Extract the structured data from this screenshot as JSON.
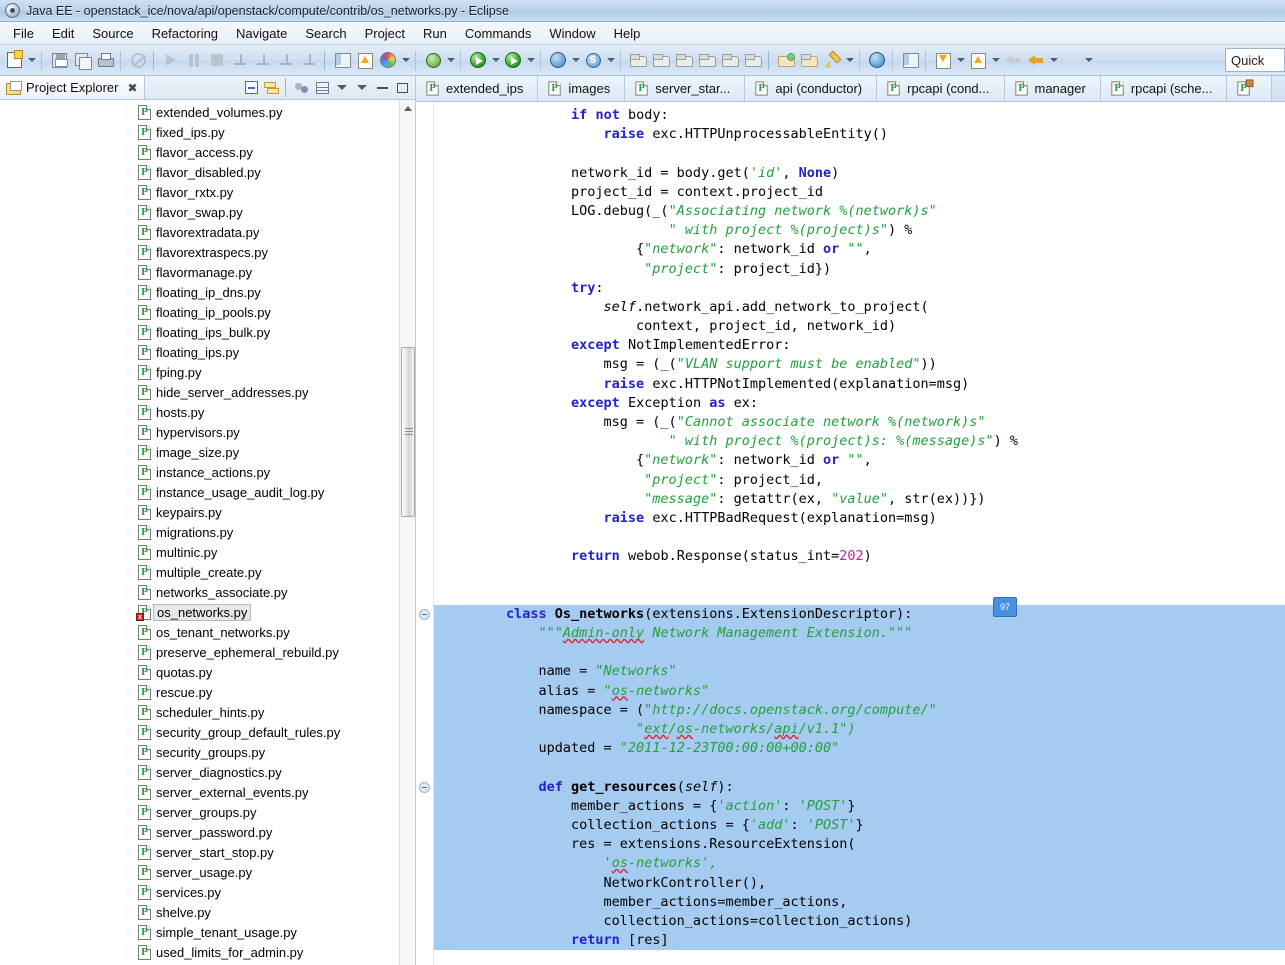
{
  "window": {
    "title": "Java EE - openstack_ice/nova/api/openstack/compute/contrib/os_networks.py - Eclipse",
    "icon": "eclipse-icon"
  },
  "menubar": {
    "items": [
      "File",
      "Edit",
      "Source",
      "Refactoring",
      "Navigate",
      "Search",
      "Project",
      "Run",
      "Commands",
      "Window",
      "Help"
    ]
  },
  "toolbar": {
    "quick_access_placeholder": "Quick ",
    "buttons": [
      "new-file",
      "new-file-dropdown",
      "save",
      "save-all",
      "print",
      "skip-breakpoints",
      "resume",
      "suspend",
      "terminate",
      "disconnect",
      "step-into",
      "step-over",
      "step-return",
      "next-annotation",
      "previous-annotation",
      "color-wheel",
      "color-dropdown",
      "debug-external-tools",
      "debug",
      "debug-dropdown",
      "run",
      "run-dropdown",
      "run-server",
      "run-server-dropdown",
      "new-web-project",
      "web-dropdown",
      "new-server",
      "server-dropdown",
      "package-1",
      "package-2",
      "package-3",
      "package-4",
      "package-5",
      "package-6",
      "open-package",
      "open-folder",
      "edit-pencil",
      "pencil-dropdown",
      "open-perspective",
      "browser",
      "pydev-package",
      "download-updates",
      "updates-dropdown",
      "upload",
      "upload-dropdown",
      "back",
      "back-dropdown",
      "forward",
      "forward-dropdown"
    ]
  },
  "project_explorer": {
    "title": "Project Explorer",
    "close_label": "✖",
    "tools": [
      "collapse-all",
      "link-with-editor",
      "filter",
      "view-menu",
      "minimize",
      "maximize"
    ],
    "files": [
      {
        "name": "extended_volumes.py",
        "selected": false,
        "error": false
      },
      {
        "name": "fixed_ips.py",
        "selected": false,
        "error": false
      },
      {
        "name": "flavor_access.py",
        "selected": false,
        "error": false
      },
      {
        "name": "flavor_disabled.py",
        "selected": false,
        "error": false
      },
      {
        "name": "flavor_rxtx.py",
        "selected": false,
        "error": false
      },
      {
        "name": "flavor_swap.py",
        "selected": false,
        "error": false
      },
      {
        "name": "flavorextradata.py",
        "selected": false,
        "error": false
      },
      {
        "name": "flavorextraspecs.py",
        "selected": false,
        "error": false
      },
      {
        "name": "flavormanage.py",
        "selected": false,
        "error": false
      },
      {
        "name": "floating_ip_dns.py",
        "selected": false,
        "error": false
      },
      {
        "name": "floating_ip_pools.py",
        "selected": false,
        "error": false
      },
      {
        "name": "floating_ips_bulk.py",
        "selected": false,
        "error": false
      },
      {
        "name": "floating_ips.py",
        "selected": false,
        "error": false
      },
      {
        "name": "fping.py",
        "selected": false,
        "error": false
      },
      {
        "name": "hide_server_addresses.py",
        "selected": false,
        "error": false
      },
      {
        "name": "hosts.py",
        "selected": false,
        "error": false
      },
      {
        "name": "hypervisors.py",
        "selected": false,
        "error": false
      },
      {
        "name": "image_size.py",
        "selected": false,
        "error": false
      },
      {
        "name": "instance_actions.py",
        "selected": false,
        "error": false
      },
      {
        "name": "instance_usage_audit_log.py",
        "selected": false,
        "error": false
      },
      {
        "name": "keypairs.py",
        "selected": false,
        "error": false
      },
      {
        "name": "migrations.py",
        "selected": false,
        "error": false
      },
      {
        "name": "multinic.py",
        "selected": false,
        "error": false
      },
      {
        "name": "multiple_create.py",
        "selected": false,
        "error": false
      },
      {
        "name": "networks_associate.py",
        "selected": false,
        "error": false
      },
      {
        "name": "os_networks.py",
        "selected": true,
        "error": true
      },
      {
        "name": "os_tenant_networks.py",
        "selected": false,
        "error": false
      },
      {
        "name": "preserve_ephemeral_rebuild.py",
        "selected": false,
        "error": false
      },
      {
        "name": "quotas.py",
        "selected": false,
        "error": false
      },
      {
        "name": "rescue.py",
        "selected": false,
        "error": false
      },
      {
        "name": "scheduler_hints.py",
        "selected": false,
        "error": false
      },
      {
        "name": "security_group_default_rules.py",
        "selected": false,
        "error": false
      },
      {
        "name": "security_groups.py",
        "selected": false,
        "error": false
      },
      {
        "name": "server_diagnostics.py",
        "selected": false,
        "error": false
      },
      {
        "name": "server_external_events.py",
        "selected": false,
        "error": false
      },
      {
        "name": "server_groups.py",
        "selected": false,
        "error": false
      },
      {
        "name": "server_password.py",
        "selected": false,
        "error": false
      },
      {
        "name": "server_start_stop.py",
        "selected": false,
        "error": false
      },
      {
        "name": "server_usage.py",
        "selected": false,
        "error": false
      },
      {
        "name": "services.py",
        "selected": false,
        "error": false
      },
      {
        "name": "shelve.py",
        "selected": false,
        "error": false
      },
      {
        "name": "simple_tenant_usage.py",
        "selected": false,
        "error": false
      },
      {
        "name": "used_limits_for_admin.py",
        "selected": false,
        "error": false
      }
    ]
  },
  "editor": {
    "tabs": [
      {
        "label": "extended_ips",
        "active": false,
        "modified": false
      },
      {
        "label": "images",
        "active": false,
        "modified": false
      },
      {
        "label": "server_star...",
        "active": false,
        "modified": false
      },
      {
        "label": "api (conductor)",
        "active": false,
        "modified": false
      },
      {
        "label": "rpcapi (cond...",
        "active": false,
        "modified": false
      },
      {
        "label": "manager",
        "active": false,
        "modified": false
      },
      {
        "label": "rpcapi (sche...",
        "active": false,
        "modified": false
      },
      {
        "label": "",
        "active": false,
        "modified": true
      }
    ],
    "ime_badge": "97",
    "code_lines": [
      {
        "indent": 8,
        "tokens": [
          {
            "t": "if",
            "c": "kw2"
          },
          {
            "t": " "
          },
          {
            "t": "not",
            "c": "kw2"
          },
          {
            "t": " body:"
          }
        ]
      },
      {
        "indent": 12,
        "tokens": [
          {
            "t": "raise",
            "c": "kw2"
          },
          {
            "t": " exc.HTTPUnprocessableEntity()"
          }
        ]
      },
      {
        "indent": 0,
        "tokens": []
      },
      {
        "indent": 8,
        "tokens": [
          {
            "t": "network_id = body.get("
          },
          {
            "t": "'id'",
            "c": "str"
          },
          {
            "t": ", "
          },
          {
            "t": "None",
            "c": "kw2"
          },
          {
            "t": ")"
          }
        ]
      },
      {
        "indent": 8,
        "tokens": [
          {
            "t": "project_id = context.project_id"
          }
        ]
      },
      {
        "indent": 8,
        "tokens": [
          {
            "t": "LOG.debug(_("
          },
          {
            "t": "\"Associating network %(network)s\"",
            "c": "str"
          }
        ]
      },
      {
        "indent": 20,
        "tokens": [
          {
            "t": "\" with project %(project)s\"",
            "c": "str"
          },
          {
            "t": ") %"
          }
        ]
      },
      {
        "indent": 16,
        "tokens": [
          {
            "t": "{"
          },
          {
            "t": "\"network\"",
            "c": "str"
          },
          {
            "t": ": network_id "
          },
          {
            "t": "or",
            "c": "kw2"
          },
          {
            "t": " "
          },
          {
            "t": "\"\"",
            "c": "str"
          },
          {
            "t": ","
          }
        ]
      },
      {
        "indent": 17,
        "tokens": [
          {
            "t": "\"project\"",
            "c": "str"
          },
          {
            "t": ": project_id})"
          }
        ]
      },
      {
        "indent": 8,
        "tokens": [
          {
            "t": "try",
            "c": "kw2"
          },
          {
            "t": ":"
          }
        ]
      },
      {
        "indent": 12,
        "tokens": [
          {
            "t": "self",
            "c": "it"
          },
          {
            "t": ".network_api.add_network_to_project("
          }
        ]
      },
      {
        "indent": 16,
        "tokens": [
          {
            "t": "context, project_id, network_id)"
          }
        ]
      },
      {
        "indent": 8,
        "tokens": [
          {
            "t": "except",
            "c": "kw2"
          },
          {
            "t": " NotImplementedError:"
          }
        ]
      },
      {
        "indent": 12,
        "tokens": [
          {
            "t": "msg = (_("
          },
          {
            "t": "\"VLAN support must be enabled\"",
            "c": "str"
          },
          {
            "t": "))"
          }
        ]
      },
      {
        "indent": 12,
        "tokens": [
          {
            "t": "raise",
            "c": "kw2"
          },
          {
            "t": " exc.HTTPNotImplemented(explanation=msg)"
          }
        ]
      },
      {
        "indent": 8,
        "tokens": [
          {
            "t": "except",
            "c": "kw2"
          },
          {
            "t": " Exception "
          },
          {
            "t": "as",
            "c": "kw2"
          },
          {
            "t": " ex:"
          }
        ]
      },
      {
        "indent": 12,
        "tokens": [
          {
            "t": "msg = (_("
          },
          {
            "t": "\"Cannot associate network %(network)s\"",
            "c": "str"
          }
        ]
      },
      {
        "indent": 20,
        "tokens": [
          {
            "t": "\" with project %(project)s: %(message)s\"",
            "c": "str"
          },
          {
            "t": ") %"
          }
        ]
      },
      {
        "indent": 16,
        "tokens": [
          {
            "t": "{"
          },
          {
            "t": "\"network\"",
            "c": "str"
          },
          {
            "t": ": network_id "
          },
          {
            "t": "or",
            "c": "kw2"
          },
          {
            "t": " "
          },
          {
            "t": "\"\"",
            "c": "str"
          },
          {
            "t": ","
          }
        ]
      },
      {
        "indent": 17,
        "tokens": [
          {
            "t": "\"project\"",
            "c": "str"
          },
          {
            "t": ": project_id,"
          }
        ]
      },
      {
        "indent": 17,
        "tokens": [
          {
            "t": "\"message\"",
            "c": "str"
          },
          {
            "t": ": getattr(ex, "
          },
          {
            "t": "\"value\"",
            "c": "str"
          },
          {
            "t": ", str(ex))})"
          }
        ]
      },
      {
        "indent": 12,
        "tokens": [
          {
            "t": "raise",
            "c": "kw2"
          },
          {
            "t": " exc.HTTPBadRequest(explanation=msg)"
          }
        ]
      },
      {
        "indent": 0,
        "tokens": []
      },
      {
        "indent": 8,
        "tokens": [
          {
            "t": "return",
            "c": "kw2"
          },
          {
            "t": " webob.Response(status_int="
          },
          {
            "t": "202",
            "c": "num"
          },
          {
            "t": ")"
          }
        ]
      },
      {
        "indent": 0,
        "tokens": []
      },
      {
        "indent": 0,
        "tokens": []
      }
    ],
    "selected_lines": [
      {
        "indent": 0,
        "fold": true,
        "tokens": [
          {
            "t": "class",
            "c": "kw2"
          },
          {
            "t": " "
          },
          {
            "t": "Os_networks",
            "c": "fn"
          },
          {
            "t": "(extensions.ExtensionDescriptor):"
          }
        ]
      },
      {
        "indent": 4,
        "tokens": [
          {
            "t": "\"\"\"",
            "c": "doc"
          },
          {
            "t": "Admin-only",
            "c": "doc sq"
          },
          {
            "t": " Network Management Extension.\"\"\"",
            "c": "doc"
          }
        ]
      },
      {
        "indent": 0,
        "tokens": []
      },
      {
        "indent": 4,
        "tokens": [
          {
            "t": "name = "
          },
          {
            "t": "\"Networks\"",
            "c": "str"
          }
        ]
      },
      {
        "indent": 4,
        "tokens": [
          {
            "t": "alias = "
          },
          {
            "t": "\"",
            "c": "str"
          },
          {
            "t": "os",
            "c": "str sq"
          },
          {
            "t": "-networks\"",
            "c": "str"
          }
        ]
      },
      {
        "indent": 4,
        "tokens": [
          {
            "t": "namespace = ("
          },
          {
            "t": "\"http://docs.openstack.org/compute/\"",
            "c": "str"
          }
        ]
      },
      {
        "indent": 16,
        "tokens": [
          {
            "t": "\"",
            "c": "str"
          },
          {
            "t": "ext",
            "c": "str sq"
          },
          {
            "t": "/",
            "c": "str"
          },
          {
            "t": "os",
            "c": "str sq"
          },
          {
            "t": "-networks/",
            "c": "str"
          },
          {
            "t": "api",
            "c": "str sq"
          },
          {
            "t": "/v1.1\")",
            "c": "str"
          }
        ]
      },
      {
        "indent": 4,
        "tokens": [
          {
            "t": "updated = "
          },
          {
            "t": "\"2011-12-23T00:00:00+00:00\"",
            "c": "str"
          }
        ]
      },
      {
        "indent": 0,
        "tokens": []
      },
      {
        "indent": 4,
        "fold": true,
        "tokens": [
          {
            "t": "def",
            "c": "kw2"
          },
          {
            "t": " "
          },
          {
            "t": "get_resources",
            "c": "fn"
          },
          {
            "t": "("
          },
          {
            "t": "self",
            "c": "it"
          },
          {
            "t": "):"
          }
        ]
      },
      {
        "indent": 8,
        "tokens": [
          {
            "t": "member_actions = {"
          },
          {
            "t": "'action'",
            "c": "str"
          },
          {
            "t": ": "
          },
          {
            "t": "'POST'",
            "c": "str"
          },
          {
            "t": "}"
          }
        ]
      },
      {
        "indent": 8,
        "tokens": [
          {
            "t": "collection_actions = {"
          },
          {
            "t": "'add'",
            "c": "str"
          },
          {
            "t": ": "
          },
          {
            "t": "'POST'",
            "c": "str"
          },
          {
            "t": "}"
          }
        ]
      },
      {
        "indent": 8,
        "tokens": [
          {
            "t": "res = extensions.ResourceExtension("
          }
        ]
      },
      {
        "indent": 12,
        "tokens": [
          {
            "t": "'",
            "c": "str"
          },
          {
            "t": "os",
            "c": "str sq"
          },
          {
            "t": "-networks',",
            "c": "str"
          }
        ]
      },
      {
        "indent": 12,
        "tokens": [
          {
            "t": "NetworkController(),"
          }
        ]
      },
      {
        "indent": 12,
        "tokens": [
          {
            "t": "member_actions=member_actions,"
          }
        ]
      },
      {
        "indent": 12,
        "tokens": [
          {
            "t": "collection_actions=collection_actions)"
          }
        ]
      },
      {
        "indent": 8,
        "tokens": [
          {
            "t": "return",
            "c": "kw2"
          },
          {
            "t": " [res]"
          }
        ]
      }
    ]
  }
}
